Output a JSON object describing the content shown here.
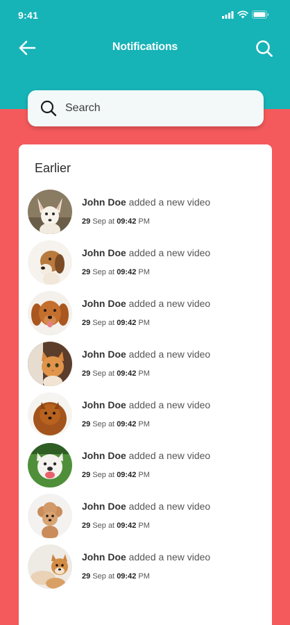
{
  "status_bar": {
    "time": "9:41"
  },
  "header": {
    "title": "Notifications",
    "back_icon": "arrow-left-icon",
    "search_icon": "search-icon"
  },
  "search": {
    "placeholder": "Search"
  },
  "section": {
    "title": "Earlier"
  },
  "colors": {
    "header_bg": "#16b3b7",
    "page_bg": "#f45a5c",
    "card_bg": "#ffffff"
  },
  "notifications": [
    {
      "name": "John Doe",
      "action": "added a new video",
      "day": "29",
      "month_at": "Sep at",
      "clock": "09:42",
      "ampm": "PM",
      "avatar": "dog-fennec-white"
    },
    {
      "name": "John Doe",
      "action": "added a new video",
      "day": "29",
      "month_at": "Sep at",
      "clock": "09:42",
      "ampm": "PM",
      "avatar": "dog-beagle"
    },
    {
      "name": "John Doe",
      "action": "added a new video",
      "day": "29",
      "month_at": "Sep at",
      "clock": "09:42",
      "ampm": "PM",
      "avatar": "dog-golden"
    },
    {
      "name": "John Doe",
      "action": "added a new video",
      "day": "29",
      "month_at": "Sep at",
      "clock": "09:42",
      "ampm": "PM",
      "avatar": "cat-orange"
    },
    {
      "name": "John Doe",
      "action": "added a new video",
      "day": "29",
      "month_at": "Sep at",
      "clock": "09:42",
      "ampm": "PM",
      "avatar": "dog-pomeranian"
    },
    {
      "name": "John Doe",
      "action": "added a new video",
      "day": "29",
      "month_at": "Sep at",
      "clock": "09:42",
      "ampm": "PM",
      "avatar": "dog-pitbull"
    },
    {
      "name": "John Doe",
      "action": "added a new video",
      "day": "29",
      "month_at": "Sep at",
      "clock": "09:42",
      "ampm": "PM",
      "avatar": "dog-poodle"
    },
    {
      "name": "John Doe",
      "action": "added a new video",
      "day": "29",
      "month_at": "Sep at",
      "clock": "09:42",
      "ampm": "PM",
      "avatar": "dog-shiba"
    }
  ]
}
